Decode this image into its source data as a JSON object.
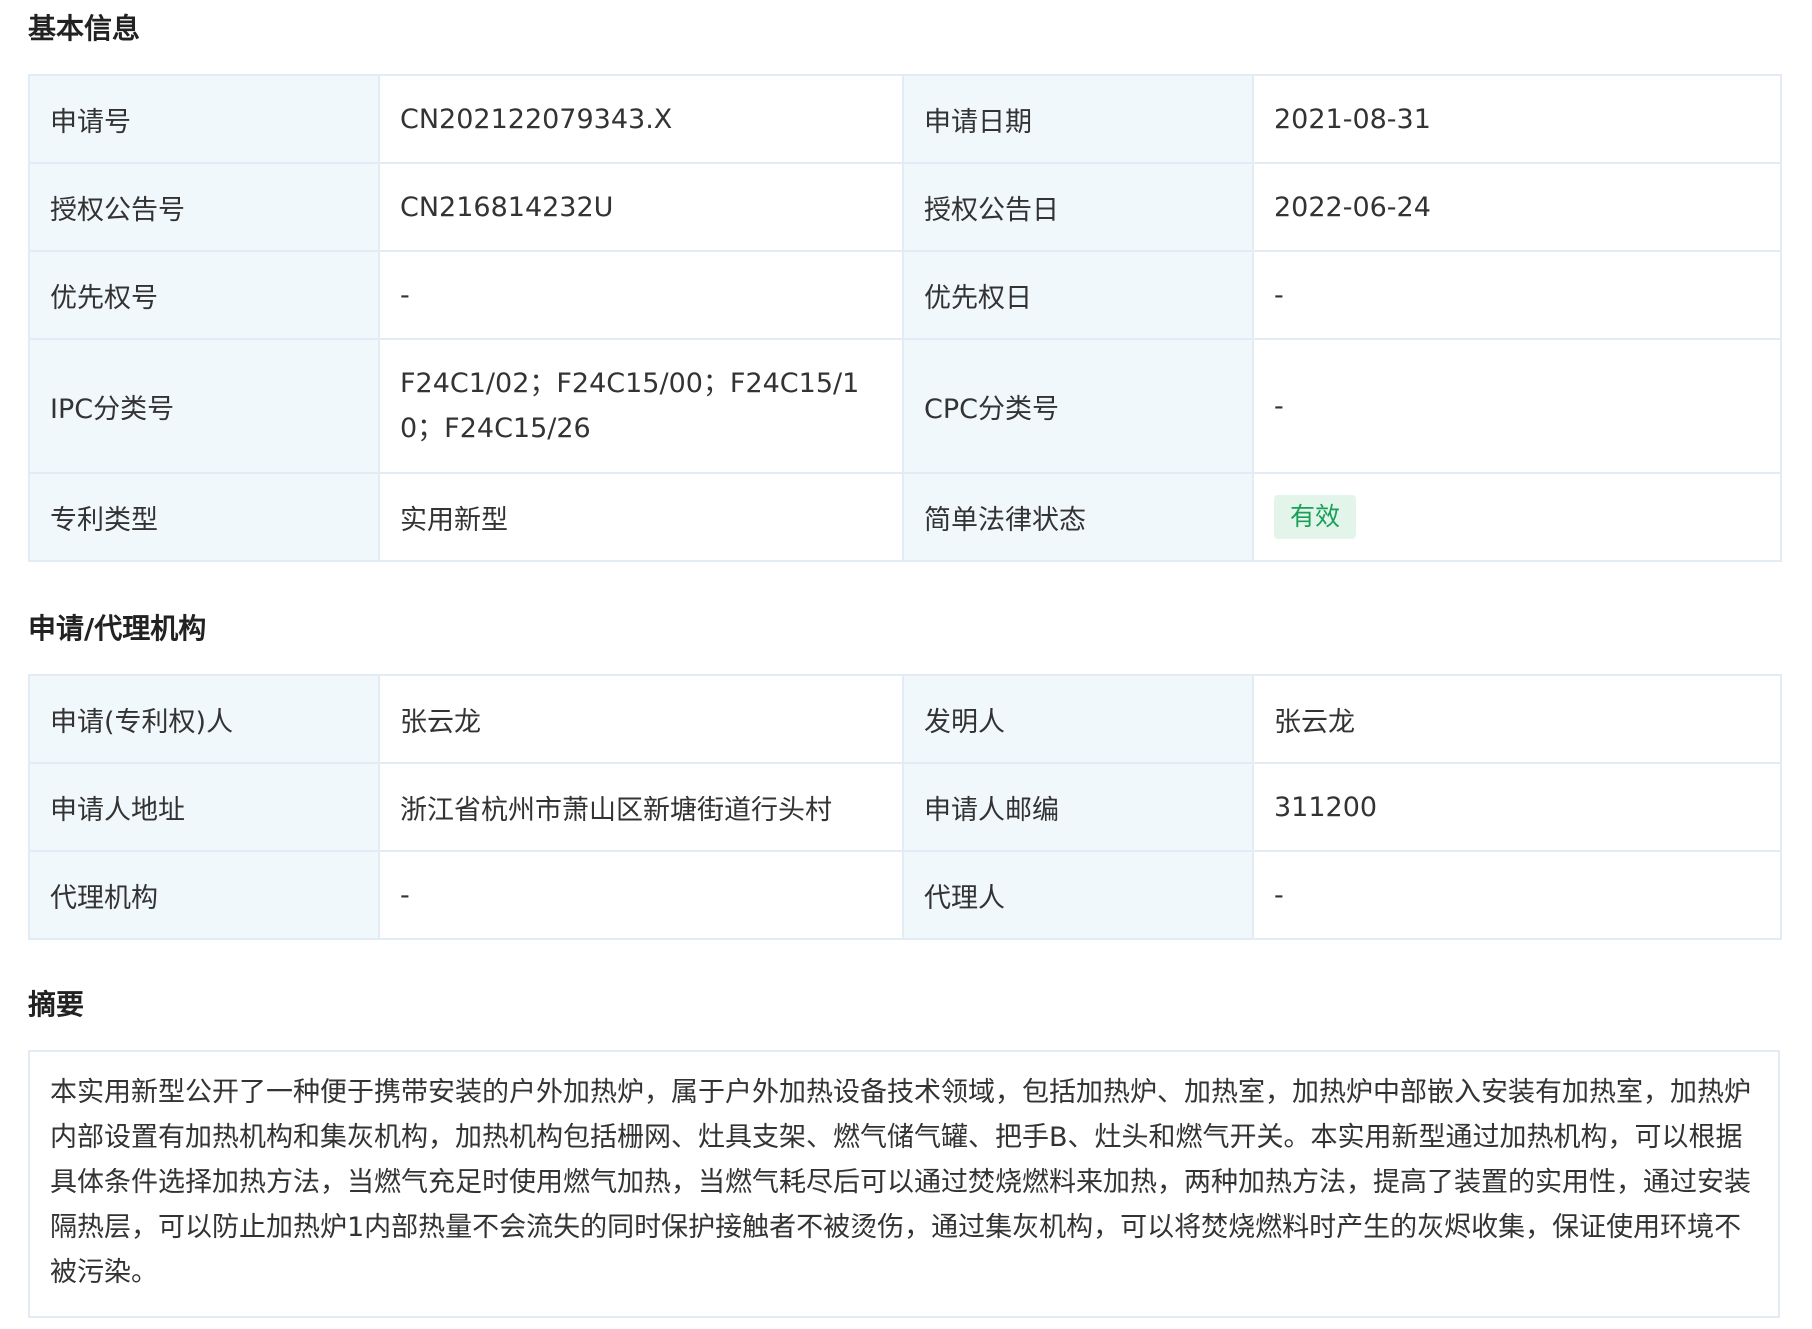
{
  "basic": {
    "title": "基本信息",
    "rows": [
      {
        "l1": "申请号",
        "v1": "CN202122079343.X",
        "l2": "申请日期",
        "v2": "2021-08-31"
      },
      {
        "l1": "授权公告号",
        "v1": "CN216814232U",
        "l2": "授权公告日",
        "v2": "2022-06-24"
      },
      {
        "l1": "优先权号",
        "v1": "-",
        "l2": "优先权日",
        "v2": "-"
      },
      {
        "l1": "IPC分类号",
        "v1": "F24C1/02；F24C15/00；F24C15/10；F24C15/26",
        "l2": "CPC分类号",
        "v2": "-"
      },
      {
        "l1": "专利类型",
        "v1": "实用新型",
        "l2": "简单法律状态",
        "v2": "有效"
      }
    ],
    "status_color": "#18a058",
    "status_bg": "#e3f5ea"
  },
  "agency": {
    "title": "申请/代理机构",
    "rows": [
      {
        "l1": "申请(专利权)人",
        "v1": "张云龙",
        "l2": "发明人",
        "v2": "张云龙"
      },
      {
        "l1": "申请人地址",
        "v1": "浙江省杭州市萧山区新塘街道行头村",
        "l2": "申请人邮编",
        "v2": "311200"
      },
      {
        "l1": "代理机构",
        "v1": "-",
        "l2": "代理人",
        "v2": "-"
      }
    ]
  },
  "abstract": {
    "title": "摘要",
    "text": "本实用新型公开了一种便于携带安装的户外加热炉，属于户外加热设备技术领域，包括加热炉、加热室，加热炉中部嵌入安装有加热室，加热炉内部设置有加热机构和集灰机构，加热机构包括栅网、灶具支架、燃气储气罐、把手B、灶头和燃气开关。本实用新型通过加热机构，可以根据具体条件选择加热方法，当燃气充足时使用燃气加热，当燃气耗尽后可以通过焚烧燃料来加热，两种加热方法，提高了装置的实用性，通过安装隔热层，可以防止加热炉1内部热量不会流失的同时保护接触者不被烫伤，通过集灰机构，可以将焚烧燃料时产生的灰烬收集，保证使用环境不被污染。"
  },
  "colors": {
    "label_bg": "#f1f8fb",
    "border": "#e3ecf4",
    "text": "#333333"
  }
}
